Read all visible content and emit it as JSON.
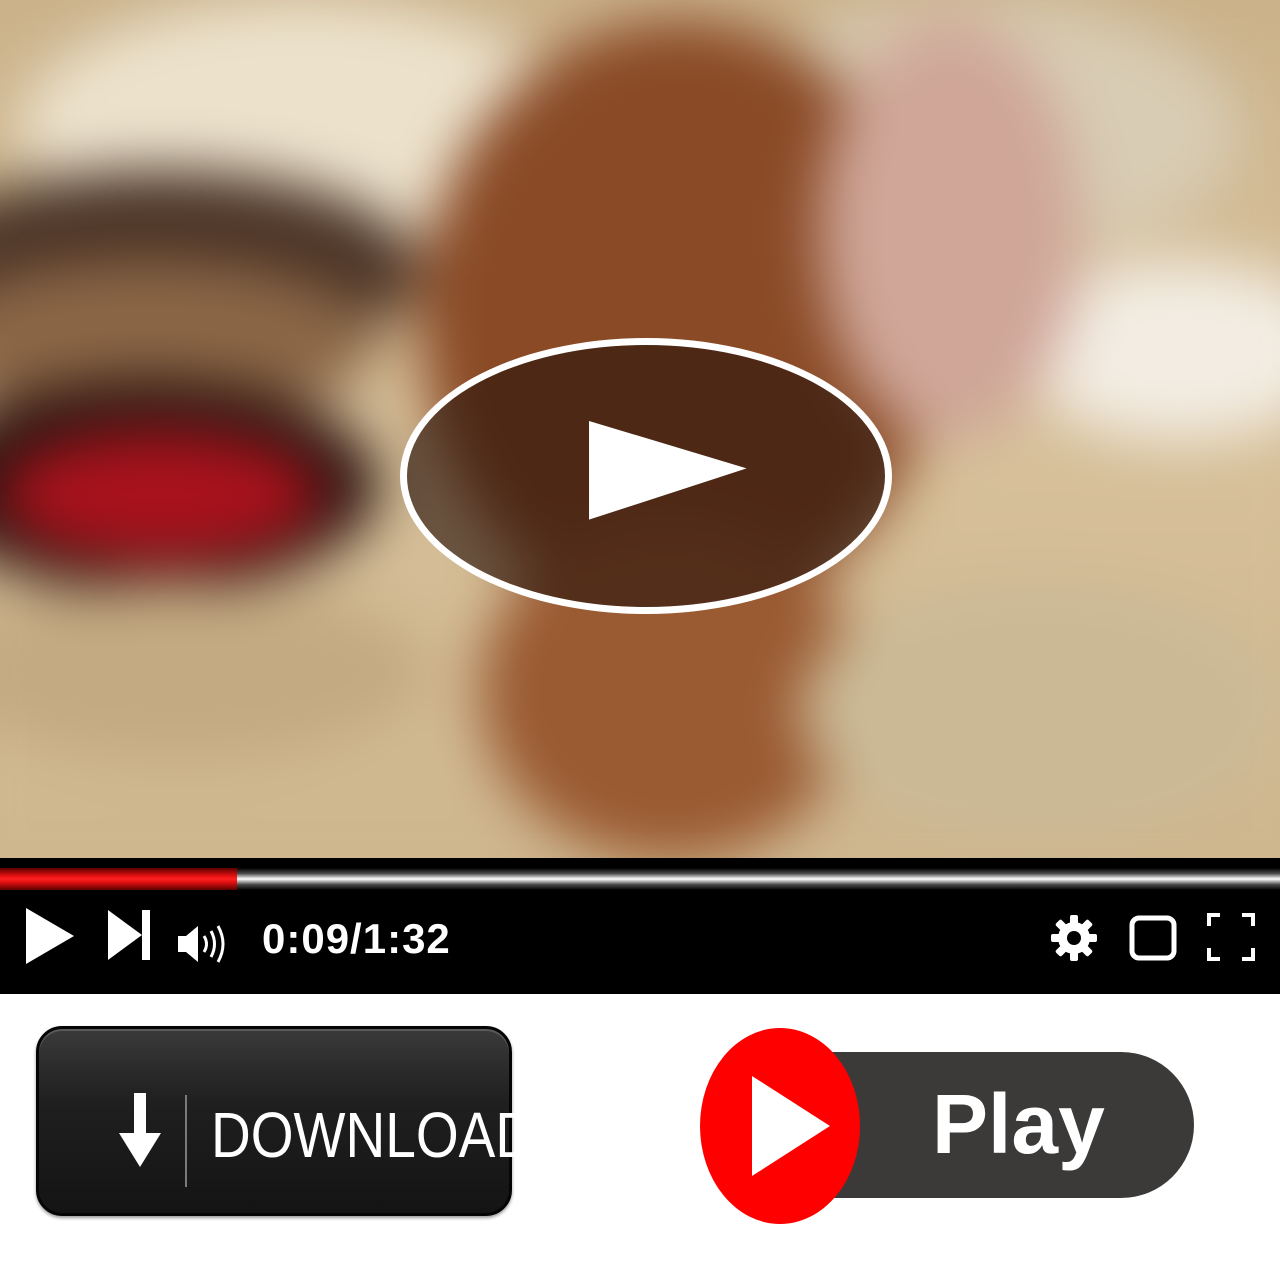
{
  "player": {
    "time_display": "0:09/1:32",
    "progress_fraction": 0.185,
    "accent_color": "#ff0000",
    "icons": {
      "big_play": "play-triangle-icon",
      "play": "play-icon",
      "next": "skip-next-icon",
      "volume": "volume-icon",
      "settings": "gear-icon",
      "miniplayer": "square-icon",
      "fullscreen": "fullscreen-icon"
    }
  },
  "actions": {
    "download_label": "DOWNLOAD",
    "download_icon": "arrow-down-icon",
    "play_label": "Play",
    "play_icon": "play-triangle-icon",
    "play_circle_color": "#ff0000",
    "pill_color": "#3c3a38"
  }
}
